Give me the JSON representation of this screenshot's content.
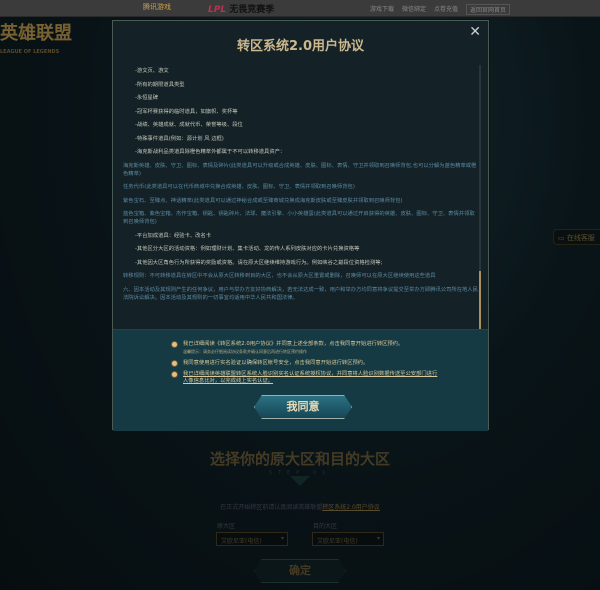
{
  "topbar": {
    "brand_tencent": "腾讯游戏",
    "brand_lpl": "LPL",
    "brand_slogan": "无畏竞赛季",
    "links": [
      "游戏下载",
      "微信绑定",
      "点卷充值",
      "返回官网首页"
    ]
  },
  "logo": {
    "title": "英雄联盟",
    "subtitle": "LEAGUE OF LEGENDS"
  },
  "customer_service": "在线客服",
  "modal": {
    "title": "转区系统2.0用户协议",
    "close": "✕",
    "items": [
      {
        "text": "-游文页、游文",
        "style": "ind"
      },
      {
        "text": "-所有的期限道具类型",
        "style": "ind"
      },
      {
        "text": "-永恒星碑",
        "style": "ind"
      },
      {
        "text": "-冠军杯赛获得的临时道具，如旗帜、奖杯等",
        "style": "ind"
      },
      {
        "text": "-战绩、英雄成就、成就代币、荣誉等级、段位",
        "style": "ind"
      },
      {
        "text": "-特殊事件道具(例如：源计划 风 边框)",
        "style": "ind"
      },
      {
        "text": "-海克斯战利品类道具除橙色精萃外都属于不可以转移道具资产：",
        "style": "ind"
      },
      {
        "text": "海克斯英雄、皮肤、守卫、图标、表情及碎片(此类道具可以升级或合成英雄、皮肤、图标、表情、守卫并领取到召唤师背包,也可以分解为蓝色精萃或橙色精萃)",
        "style": "blue"
      },
      {
        "text": "任务代币(此类道具可以在代币商城中兑换合成英雄、皮肤、图标、守卫、表情并领取到召唤师背包)",
        "style": "blue"
      },
      {
        "text": "紫色宝石、至臻点、神话精萃(此类道具可以通过神秘合成或至臻商城兑换成海克斯皮肤或至臻皮肤并领取到召唤师背包)",
        "style": "blue"
      },
      {
        "text": "蓝色宝箱、紫色宝箱、杰作宝箱、钥匙、钥匙碎片、法球、魔法引擎、小小英雄蛋(此类道具可以通过开启获得的英雄、皮肤、图标、守卫、表情并领取到召唤师背包)",
        "style": "blue"
      },
      {
        "text": "-平台加成道具：经验卡、改名卡",
        "style": "ind"
      },
      {
        "text": "-其他区分大区的活动资格：例如理财计划、集卡活动、龙的传人系列皮肤对应的卡片兑换资格等",
        "style": "ind"
      },
      {
        "text": "-其他因大区角色行为所获得的奖励或资格。请在原大区继续维持游戏行为。例如峡谷之巅段位资格检测等;",
        "style": "ind"
      },
      {
        "text": "转移规则：不可转移道具在转区中不会从原大区转移到目的大区，也不会从原大区重置或删除，召唤师可以在原大区继续使用这些道具",
        "style": "blue"
      },
      {
        "text": "六、因本活动及其规则产生的任何争议，用户与举办方友好协商解决，若无法达成一致，用户和举办方均同意将争议提交至举办方即腾讯公司所在地人民法院诉讼解决。因本活动及其规则的一切事宜均适用中华人民共和国法律。",
        "style": "blue"
      }
    ],
    "checks": [
      {
        "text": "我已详细阅读《转区系统2.0用户协议》并同意上述全部条款，点击我同意开始进行转区预约。",
        "tip": "温馨提示：请务必仔细阅读协议条款并确认同意后再进行转区预约操作"
      },
      {
        "text": "我同意使用进行实名验证以确保转区帐号安全，点击我同意开始进行转区预约。"
      },
      {
        "text": "我已详细阅读英雄联盟转区系统人脸识别实名认证系统授权协议，并同意将人脸识别数据传送至公安部门进行人像信息比对，以完成线上实名认证。"
      }
    ],
    "agree_button": "我同意"
  },
  "page": {
    "title": "选择你的原大区和目的大区",
    "step": "STEP 01",
    "note": "在正式开始转区前请认真阅读英雄联盟",
    "note_link": "转区系统2.0用户协议",
    "source_label": "原大区",
    "source_value": "艾欧尼亚(电信)",
    "target_label": "目的大区",
    "target_value": "艾欧尼亚(电信)",
    "confirm": "确定"
  }
}
